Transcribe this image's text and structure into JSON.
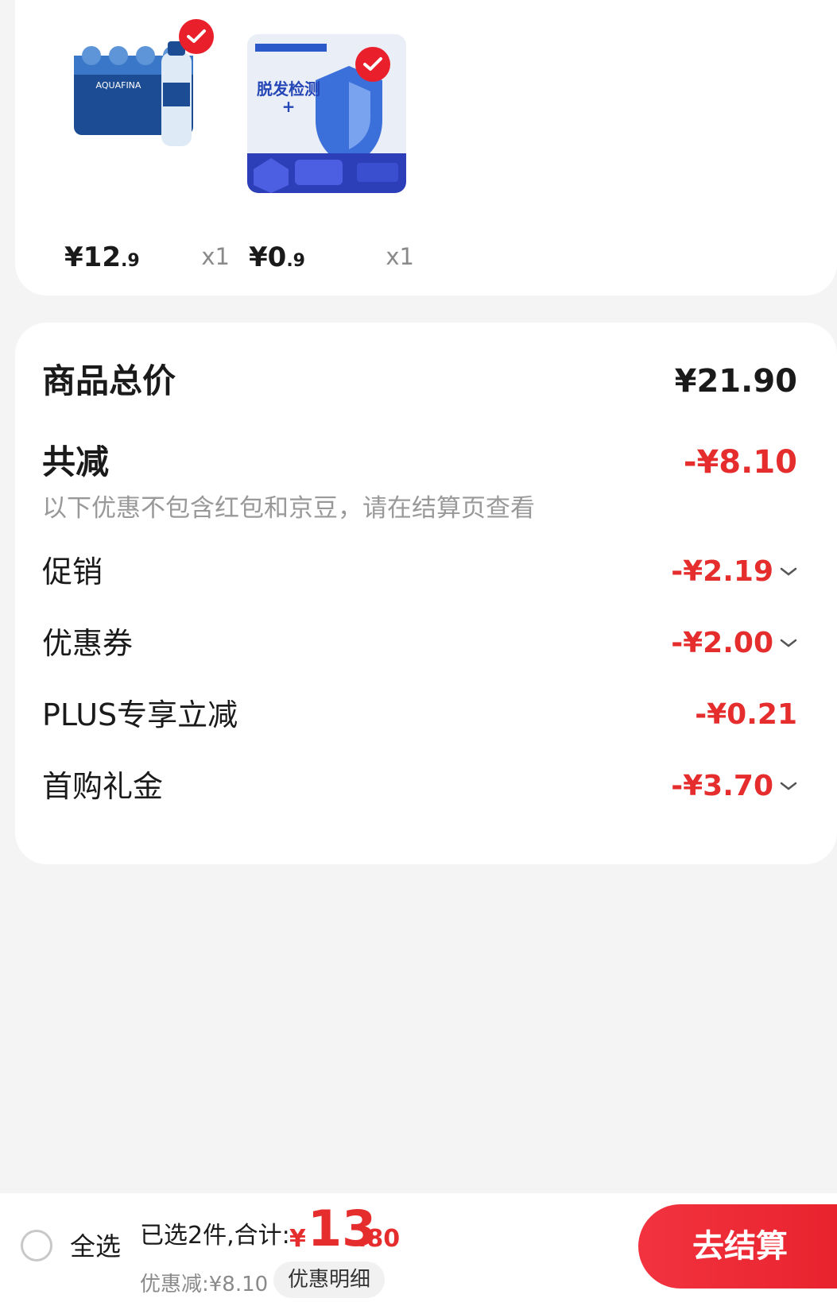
{
  "products": [
    {
      "image_label": "AQUAFINA",
      "price_int": "¥12",
      "price_dec": ".9",
      "qty": "x1"
    },
    {
      "image_label": "脱发检测",
      "price_int": "¥0",
      "price_dec": ".9",
      "qty": "x1"
    }
  ],
  "summary": {
    "total_label": "商品总价",
    "total_value": "¥21.90",
    "reduce_label": "共减",
    "reduce_value": "-¥8.10",
    "note": "以下优惠不包含红包和京豆，请在结算页查看",
    "items": [
      {
        "label": "促销",
        "value": "-¥2.19",
        "expandable": true
      },
      {
        "label": "优惠券",
        "value": "-¥2.00",
        "expandable": true
      },
      {
        "label": "PLUS专享立减",
        "value": "-¥0.21",
        "expandable": false
      },
      {
        "label": "首购礼金",
        "value": "-¥3.70",
        "expandable": true
      }
    ]
  },
  "bottom": {
    "select_all": "全选",
    "selected_text": "已选2件,合计:",
    "total_yen": "¥",
    "total_int": "13",
    "total_dec": ".80",
    "discount_text": "优惠减:¥8.10",
    "detail_button": "优惠明细",
    "checkout_button": "去结算"
  },
  "colors": {
    "accent": "#e62d2d",
    "check": "#e9202c"
  }
}
